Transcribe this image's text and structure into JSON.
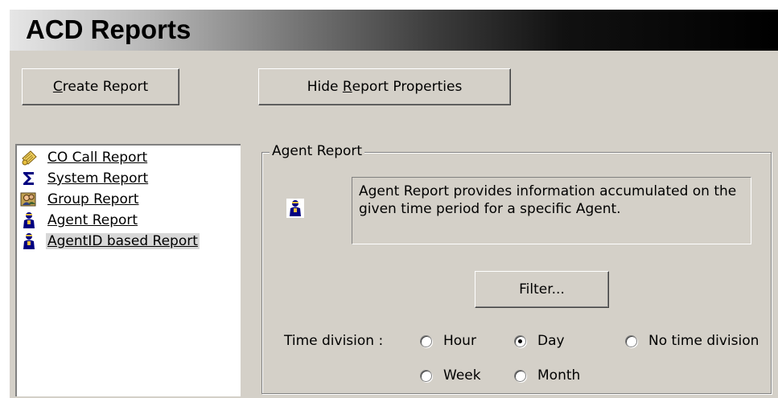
{
  "window": {
    "title": "ACD Reports"
  },
  "toolbar": {
    "create_label_ul": "C",
    "create_label_rest": "reate Report",
    "hide_label_pre": "Hide ",
    "hide_label_ul": "R",
    "hide_label_rest": "eport Properties"
  },
  "report_list": {
    "items": [
      {
        "label": "CO Call Report",
        "icon": "phone-book-icon"
      },
      {
        "label": "System Report",
        "icon": "sigma-icon"
      },
      {
        "label": "Group Report",
        "icon": "group-icon"
      },
      {
        "label": "Agent Report",
        "icon": "agent-icon"
      },
      {
        "label": "AgentID based Report",
        "icon": "agent-icon",
        "selected": true
      }
    ]
  },
  "properties": {
    "group_title": "Agent Report",
    "description": "Agent Report provides information accumulated on the given time period for a specific Agent.",
    "filter_label": "Filter...",
    "time_division_label": "Time division :",
    "options": {
      "hour": "Hour",
      "day": "Day",
      "no_division": "No time division",
      "week": "Week",
      "month": "Month"
    },
    "selected_option": "Day"
  }
}
